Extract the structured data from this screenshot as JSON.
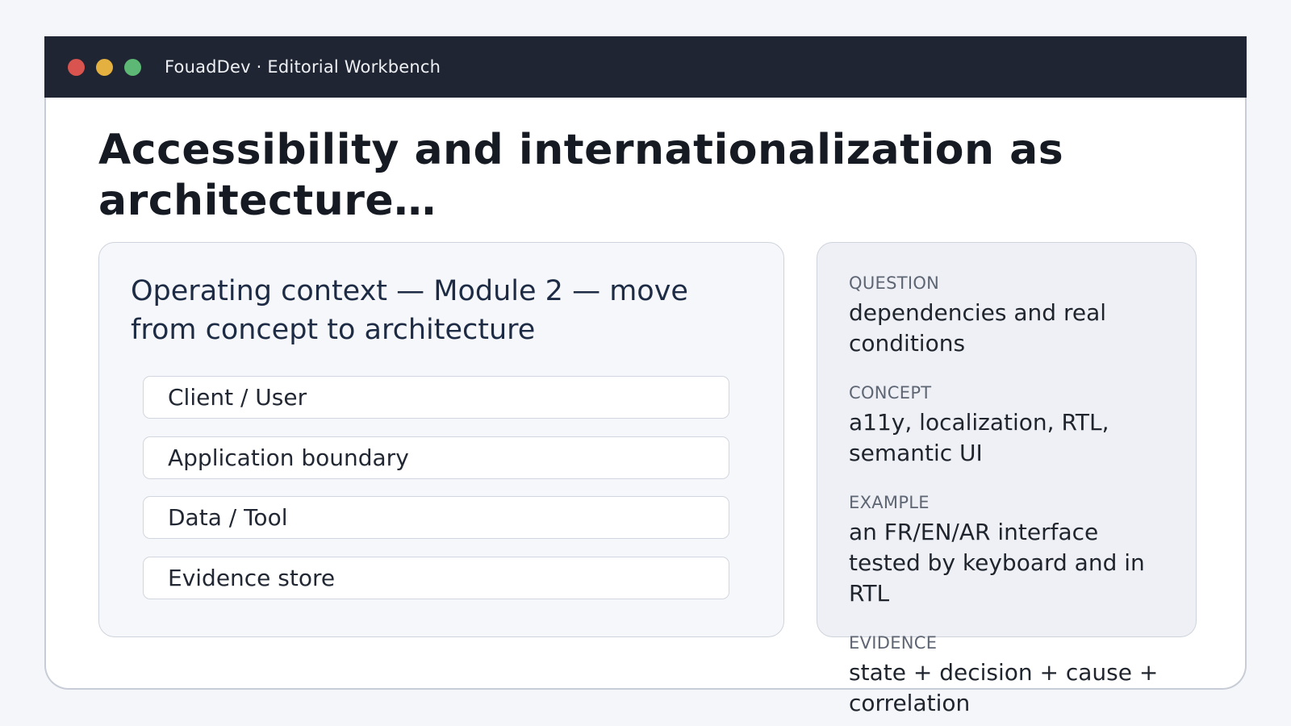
{
  "window": {
    "title": "FouadDev · Editorial Workbench",
    "controls": [
      {
        "name": "close",
        "color": "#d9534f"
      },
      {
        "name": "minimize",
        "color": "#e4b03f"
      },
      {
        "name": "maximize",
        "color": "#5cb874"
      }
    ]
  },
  "page": {
    "title": "Accessibility and internationalization as architecture…"
  },
  "context": {
    "heading": "Operating context — Module 2 — move from concept to architecture",
    "layers": [
      {
        "label": "Client / User"
      },
      {
        "label": "Application boundary"
      },
      {
        "label": "Data / Tool"
      },
      {
        "label": "Evidence store"
      }
    ]
  },
  "notes": [
    {
      "label": "QUESTION",
      "value": "dependencies and real conditions"
    },
    {
      "label": "CONCEPT",
      "value": "a11y, localization, RTL, semantic UI"
    },
    {
      "label": "EXAMPLE",
      "value": "an FR/EN/AR interface tested by keyboard and in RTL"
    },
    {
      "label": "EVIDENCE",
      "value": "state + decision + cause + correlation"
    }
  ]
}
